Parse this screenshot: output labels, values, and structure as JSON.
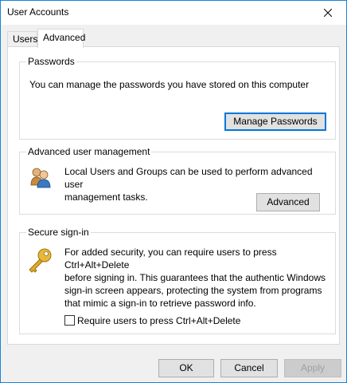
{
  "window": {
    "title": "User Accounts"
  },
  "tabs": [
    {
      "label": "Users",
      "selected": false
    },
    {
      "label": "Advanced",
      "selected": true
    }
  ],
  "passwords": {
    "group_label": "Passwords",
    "description": "You can manage the passwords you have stored on this computer",
    "button_label": "Manage Passwords"
  },
  "advanced_management": {
    "group_label": "Advanced user management",
    "description_line1": "Local Users and Groups can be used to perform advanced user",
    "description_line2": "management tasks.",
    "button_label": "Advanced",
    "icon": "users-group-icon"
  },
  "secure_signin": {
    "group_label": "Secure sign-in",
    "description_lines": [
      "For added security, you can require users to press Ctrl+Alt+Delete",
      "before signing in. This guarantees that the authentic Windows",
      "sign-in screen appears, protecting the system from programs",
      "that mimic a sign-in to retrieve password info."
    ],
    "checkbox_label": "Require users to press Ctrl+Alt+Delete",
    "checkbox_checked": false,
    "icon": "key-icon"
  },
  "footer": {
    "ok_label": "OK",
    "cancel_label": "Cancel",
    "apply_label": "Apply",
    "apply_enabled": false
  },
  "colors": {
    "accent": "#0078d7",
    "window_border": "#1883d7",
    "background": "#f0f0f0",
    "panel": "#ffffff"
  }
}
